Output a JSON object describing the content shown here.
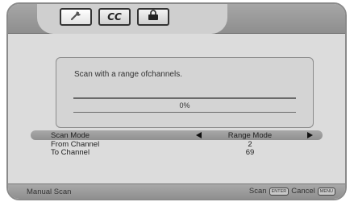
{
  "tabs": [
    {
      "icon": "wrench-icon",
      "active": true
    },
    {
      "label": "CC",
      "active": false
    },
    {
      "icon": "lock-icon",
      "active": false
    }
  ],
  "dialog": {
    "message": "Scan with a range ofchannels.",
    "progress_text": "0%",
    "progress": 0
  },
  "settings": [
    {
      "label": "Scan Mode",
      "value": "Range Mode"
    },
    {
      "label": "From Channel",
      "value": "2"
    },
    {
      "label": "To Channel",
      "value": "69"
    }
  ],
  "status": {
    "title": "Manual Scan",
    "scan_label": "Scan",
    "scan_key": "ENTER",
    "cancel_label": "Cancel",
    "cancel_key": "MENU"
  }
}
